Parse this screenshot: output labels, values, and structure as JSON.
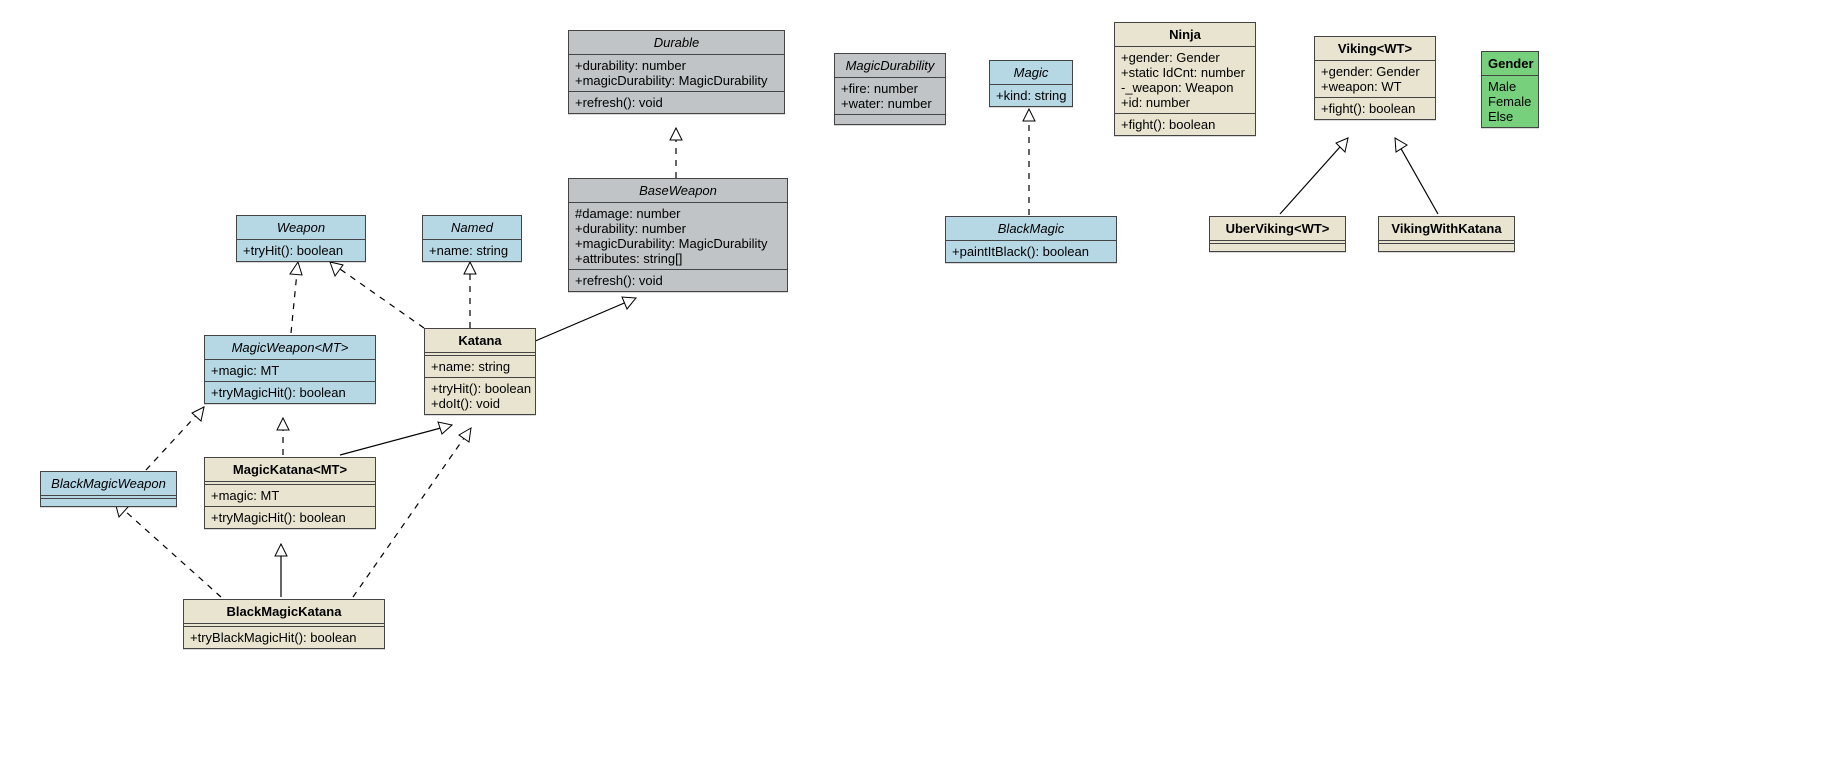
{
  "colors": {
    "interface": "#b6d7e4",
    "abstract": "#c0c4c6",
    "class": "#e8e4cf",
    "enum": "#77d17c"
  },
  "boxes": {
    "Durable": {
      "title": "Durable",
      "titleStyle": "italic",
      "sections": [
        [
          "+durability: number",
          "+magicDurability: MagicDurability"
        ],
        [
          "+refresh(): void"
        ]
      ]
    },
    "MagicDurability": {
      "title": "MagicDurability",
      "titleStyle": "italic",
      "sections": [
        [
          "+fire: number",
          "+water: number"
        ],
        []
      ]
    },
    "Magic": {
      "title": "Magic",
      "titleStyle": "italic",
      "sections": [
        [
          "+kind: string"
        ]
      ]
    },
    "Ninja": {
      "title": "Ninja",
      "sections": [
        [
          "+gender: Gender",
          "+static IdCnt: number",
          "-_weapon: Weapon",
          "+id: number"
        ],
        [
          "+fight(): boolean"
        ]
      ]
    },
    "Viking": {
      "title": "Viking<WT>",
      "sections": [
        [
          "+gender: Gender",
          "+weapon: WT"
        ],
        [
          "+fight(): boolean"
        ]
      ]
    },
    "Gender": {
      "title": "Gender",
      "sections": [
        [
          "Male",
          "Female",
          "Else"
        ]
      ]
    },
    "Weapon": {
      "title": "Weapon",
      "titleStyle": "italic",
      "sections": [
        [
          "+tryHit(): boolean"
        ]
      ]
    },
    "Named": {
      "title": "Named",
      "titleStyle": "italic",
      "sections": [
        [
          "+name: string"
        ]
      ]
    },
    "BaseWeapon": {
      "title": "BaseWeapon",
      "titleStyle": "italic",
      "sections": [
        [
          "#damage: number",
          "+durability: number",
          "+magicDurability: MagicDurability",
          "+attributes: string[]"
        ],
        [
          "+refresh(): void"
        ]
      ]
    },
    "BlackMagic": {
      "title": "BlackMagic",
      "titleStyle": "italic",
      "sections": [
        [
          "+paintItBlack(): boolean"
        ]
      ]
    },
    "UberViking": {
      "title": "UberViking<WT>",
      "sections": [
        []
      ]
    },
    "VikingWithKatana": {
      "title": "VikingWithKatana",
      "sections": [
        []
      ]
    },
    "MagicWeapon": {
      "title": "MagicWeapon<MT>",
      "titleStyle": "italic",
      "sections": [
        [
          "+magic: MT"
        ],
        [
          "+tryMagicHit(): boolean"
        ]
      ]
    },
    "Katana": {
      "title": "Katana",
      "sections": [
        [
          "+name: string"
        ],
        [
          "+tryHit(): boolean",
          "+doIt(): void"
        ]
      ]
    },
    "BlackMagicWeapon": {
      "title": "BlackMagicWeapon",
      "titleStyle": "italic",
      "sections": [
        []
      ]
    },
    "MagicKatana": {
      "title": "MagicKatana<MT>",
      "sections": [
        [
          "+magic: MT"
        ],
        [
          "+tryMagicHit(): boolean"
        ]
      ]
    },
    "BlackMagicKatana": {
      "title": "BlackMagicKatana",
      "sections": [
        [
          "+tryBlackMagicHit(): boolean"
        ]
      ]
    }
  }
}
